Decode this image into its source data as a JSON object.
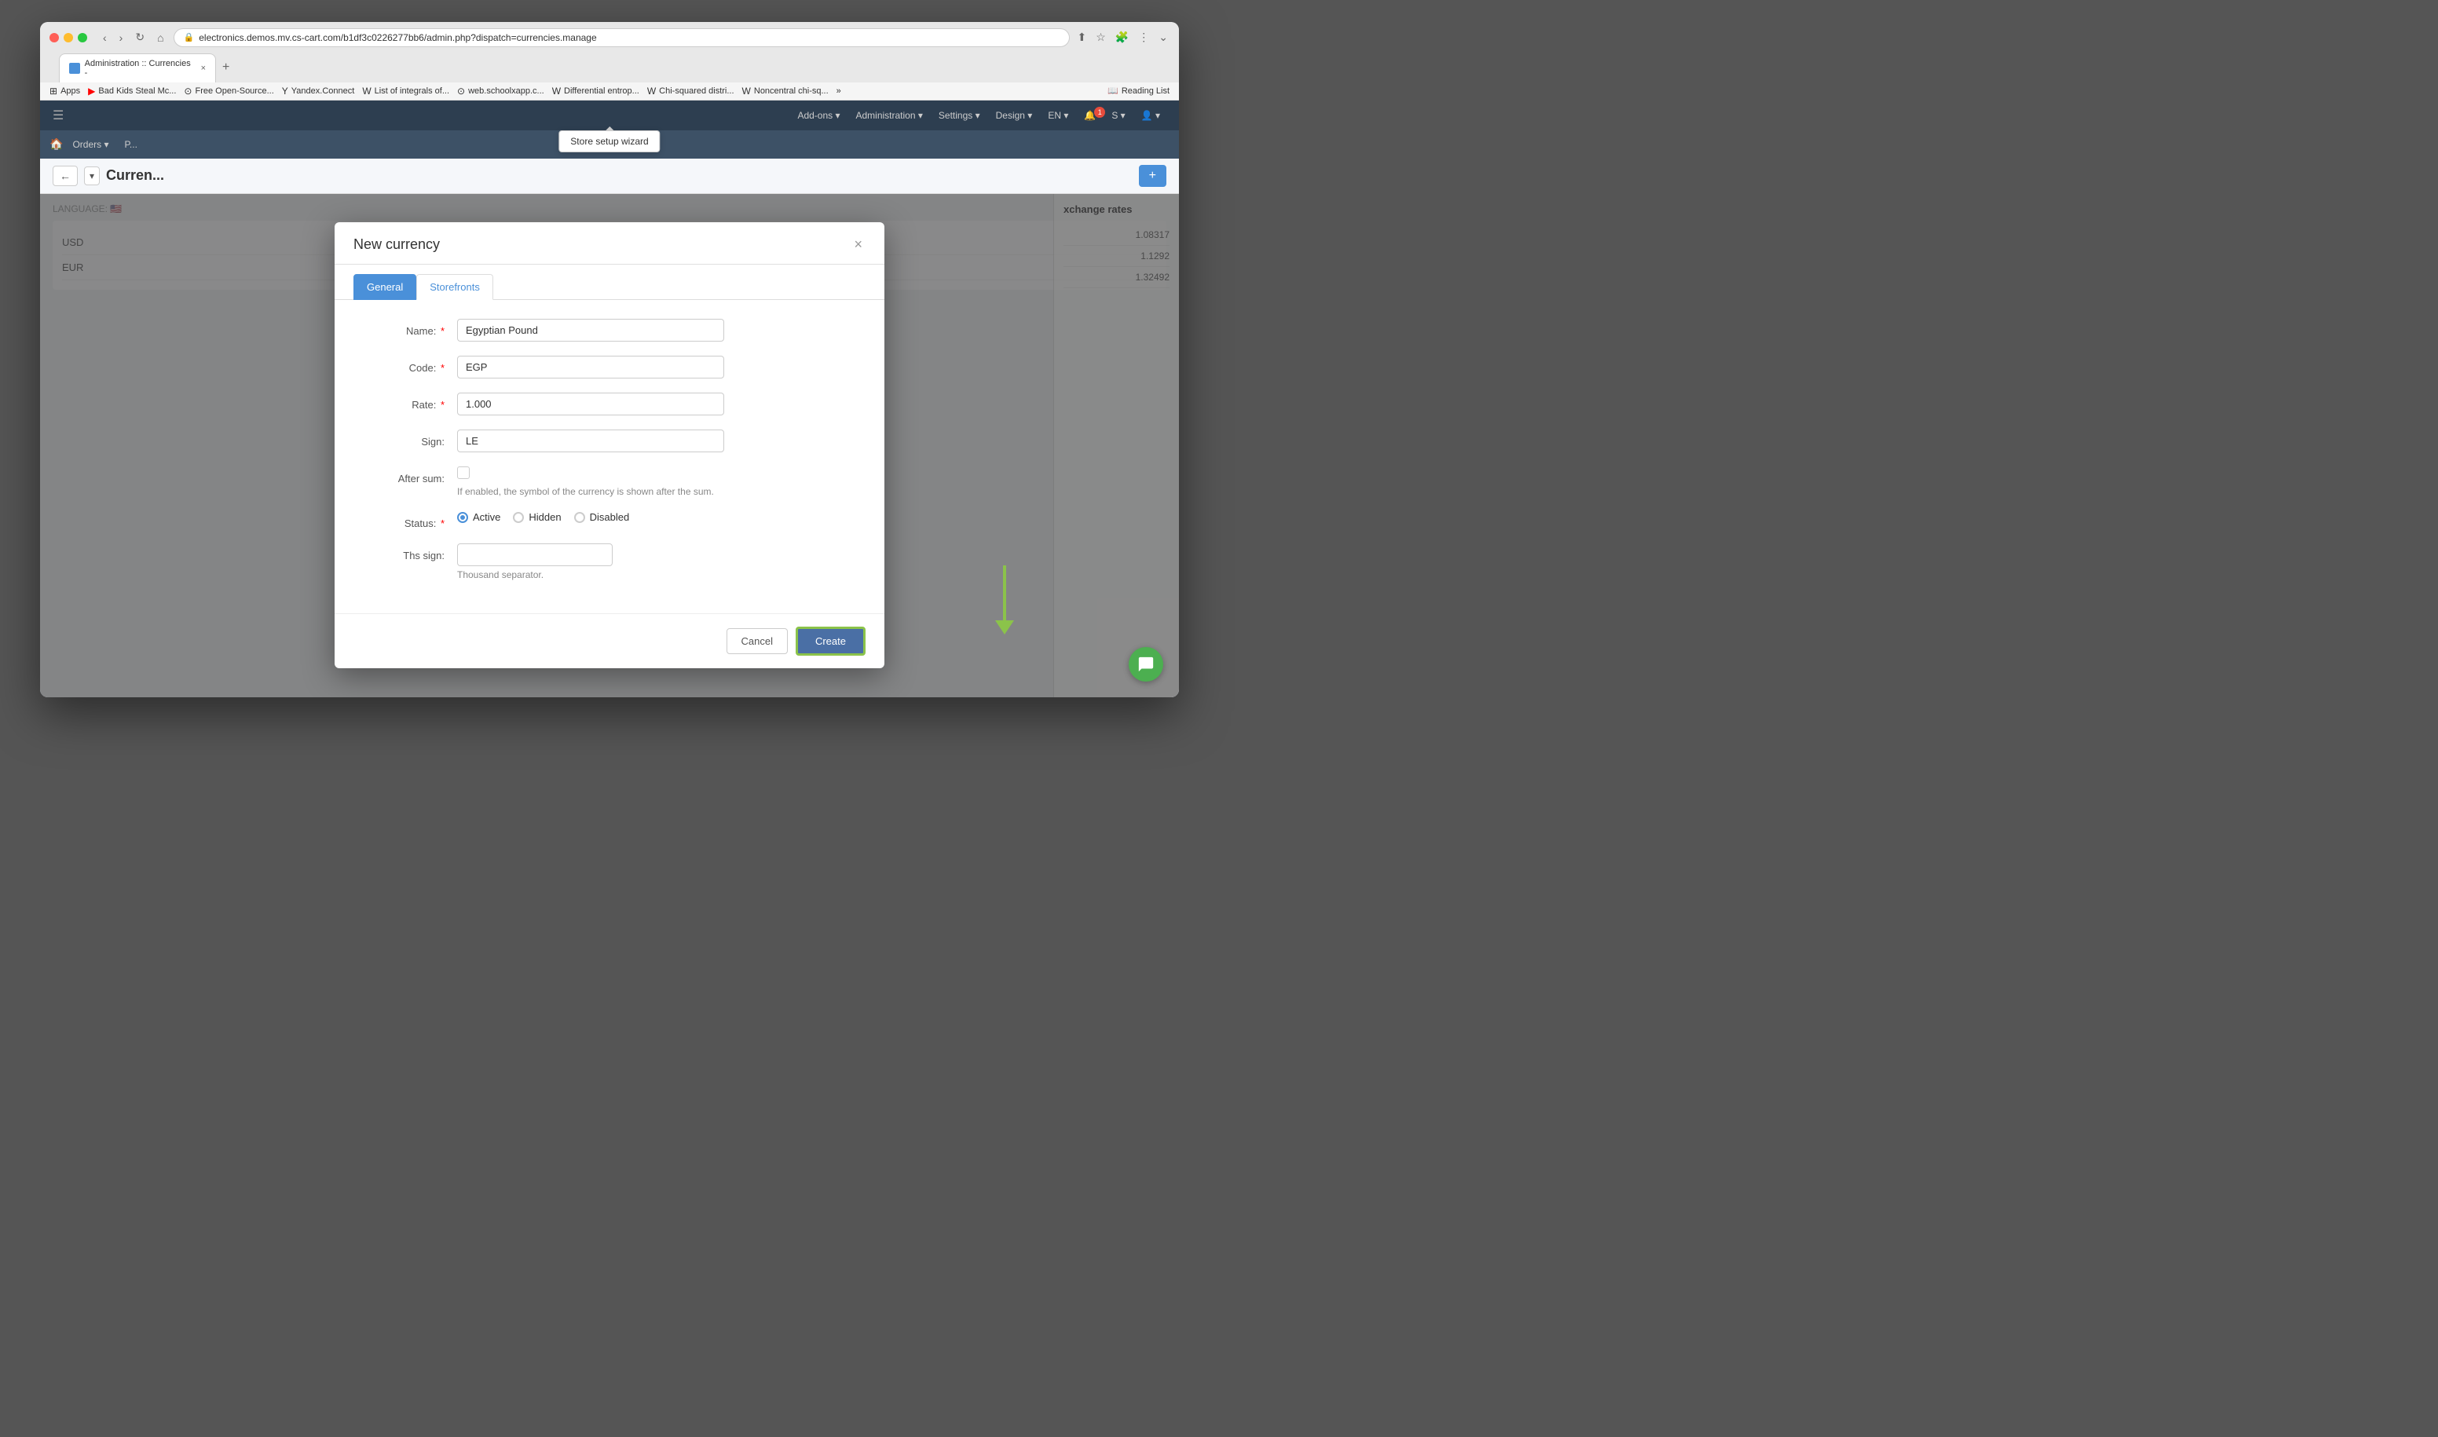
{
  "browser": {
    "url": "electronics.demos.mv.cs-cart.com/b1df3c0226277bb6/admin.php?dispatch=currencies.manage",
    "tab_title": "Administration :: Currencies -",
    "new_tab_icon": "+",
    "close_icon": "×",
    "chevron_icon": "⌄"
  },
  "bookmarks": {
    "items": [
      {
        "id": "apps",
        "label": "Apps",
        "icon": "⊞"
      },
      {
        "id": "bad-kids",
        "label": "Bad Kids Steal Mc...",
        "icon": "▶"
      },
      {
        "id": "free-open-source",
        "label": "Free Open-Source...",
        "icon": "⊙"
      },
      {
        "id": "yandex",
        "label": "Yandex.Connect",
        "icon": "Y"
      },
      {
        "id": "list-integrals",
        "label": "List of integrals of...",
        "icon": "W"
      },
      {
        "id": "web-school",
        "label": "web.schoolxapp.c...",
        "icon": "⊙"
      },
      {
        "id": "differential",
        "label": "Differential entrop...",
        "icon": "W"
      },
      {
        "id": "chi-squared",
        "label": "Chi-squared distri...",
        "icon": "W"
      },
      {
        "id": "noncentral",
        "label": "Noncentral chi-sq...",
        "icon": "W"
      },
      {
        "id": "more",
        "label": "»",
        "icon": ""
      }
    ],
    "reading_list": "Reading List"
  },
  "header": {
    "menu_icon": "☰",
    "nav_items": [
      {
        "label": "Add-ons",
        "id": "add-ons"
      },
      {
        "label": "Administration",
        "id": "administration"
      },
      {
        "label": "Settings",
        "id": "settings"
      },
      {
        "label": "Design",
        "id": "design"
      },
      {
        "label": "EN",
        "id": "language"
      },
      {
        "label": "1",
        "id": "notifications"
      },
      {
        "label": "S",
        "id": "store"
      },
      {
        "label": "👤",
        "id": "user"
      }
    ]
  },
  "wizard_tooltip": "Store setup wizard",
  "subnav": {
    "home_icon": "🏠",
    "items": [
      {
        "label": "Orders ▾",
        "id": "orders"
      },
      {
        "label": "P...",
        "id": "products"
      }
    ]
  },
  "breadcrumb": {
    "back_icon": "←",
    "dropdown_icon": "▾",
    "title": "Curren..."
  },
  "content": {
    "language_label": "LANGUAGE:",
    "flag_icon": "🇺🇸",
    "currencies": [
      "USD",
      "EUR"
    ],
    "exchange_rates": {
      "title": "xchange rates",
      "rows": [
        {
          "value": "1.08317"
        },
        {
          "value": "1.1292"
        },
        {
          "value": "1.32492"
        }
      ]
    }
  },
  "modal": {
    "title": "New currency",
    "close_label": "×",
    "tabs": [
      {
        "label": "General",
        "id": "general",
        "active": true
      },
      {
        "label": "Storefronts",
        "id": "storefronts",
        "active": false
      }
    ],
    "form": {
      "name_label": "Name:",
      "name_value": "Egyptian Pound",
      "name_required": true,
      "code_label": "Code:",
      "code_value": "EGP",
      "code_required": true,
      "rate_label": "Rate:",
      "rate_value": "1.000",
      "rate_required": true,
      "sign_label": "Sign:",
      "sign_value": "LE",
      "after_sum_label": "After sum:",
      "after_sum_hint": "If enabled, the symbol of the currency is shown after the sum.",
      "status_label": "Status:",
      "status_required": true,
      "status_options": [
        {
          "label": "Active",
          "value": "active",
          "checked": true
        },
        {
          "label": "Hidden",
          "value": "hidden",
          "checked": false
        },
        {
          "label": "Disabled",
          "value": "disabled",
          "checked": false
        }
      ],
      "ths_sign_label": "Ths sign:",
      "ths_sign_value": "",
      "ths_sign_hint": "Thousand separator."
    },
    "footer": {
      "cancel_label": "Cancel",
      "create_label": "Create"
    }
  },
  "chat": {
    "icon": "💬"
  }
}
